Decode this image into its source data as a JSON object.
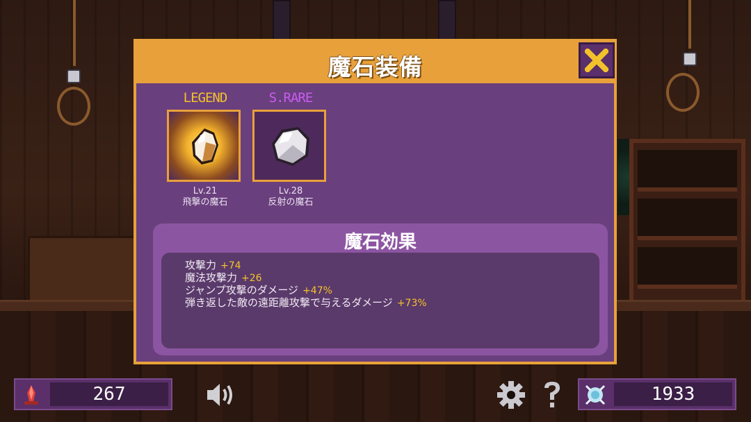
{
  "dialog": {
    "title": "魔石装備",
    "close_icon": "close-x-icon"
  },
  "stones": [
    {
      "rarity": "LEGEND",
      "level": "Lv.21",
      "name": "飛撃の魔石",
      "icon": "legend-gem-icon",
      "rarity_color": "#f3c22b"
    },
    {
      "rarity": "S.RARE",
      "level": "Lv.28",
      "name": "反射の魔石",
      "icon": "white-gem-icon",
      "rarity_color": "#c85cf0"
    }
  ],
  "effects": {
    "title": "魔石効果",
    "rows": [
      {
        "label": "攻撃力",
        "value": "+74"
      },
      {
        "label": "魔法攻撃力",
        "value": "+26"
      },
      {
        "label": "ジャンプ攻撃のダメージ",
        "value": "+47%"
      },
      {
        "label": "弾き返した敵の遠距離攻撃で与えるダメージ",
        "value": "+73%"
      }
    ]
  },
  "hud": {
    "left_counter": {
      "icon": "red-crystal-icon",
      "value": "267"
    },
    "right_counter": {
      "icon": "soul-orb-icon",
      "value": "1933"
    },
    "sound_icon": "speaker-icon",
    "settings_icon": "gear-icon",
    "help_icon": "question-icon"
  },
  "colors": {
    "accent": "#e8a13a",
    "panel": "#6a3f7d",
    "value_highlight": "#f3c22b"
  }
}
